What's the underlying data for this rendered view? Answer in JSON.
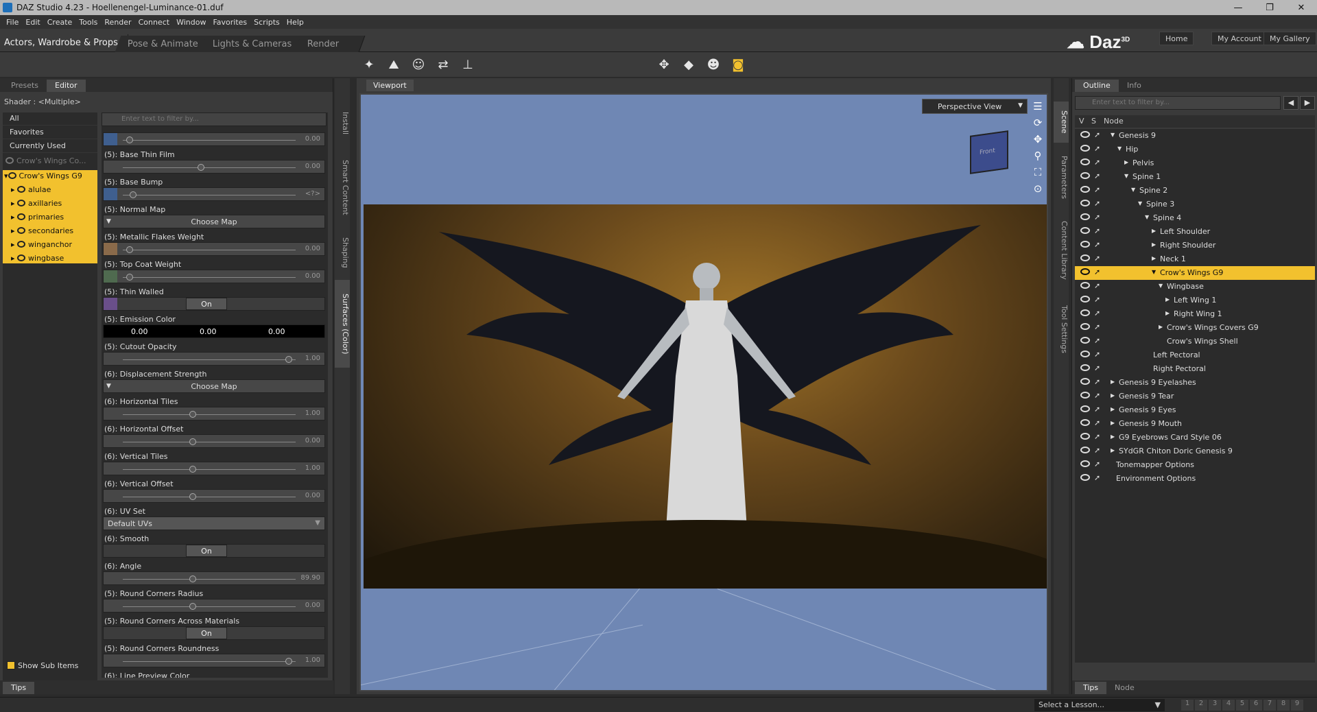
{
  "window": {
    "title": "DAZ Studio 4.23 - Hoellenengel-Luminance-01.duf",
    "controls": [
      "—",
      "❐",
      "✕"
    ]
  },
  "menu": [
    "File",
    "Edit",
    "Create",
    "Tools",
    "Render",
    "Connect",
    "Window",
    "Favorites",
    "Scripts",
    "Help"
  ],
  "main_tabs": [
    "Actors, Wardrobe & Props",
    "Pose & Animate",
    "Lights & Cameras",
    "Render"
  ],
  "brand": {
    "name": "Daz",
    "sup": "3D"
  },
  "top_links": [
    "Home",
    "My Account",
    "My Gallery"
  ],
  "left_panel": {
    "tabs": [
      "Presets",
      "Editor"
    ],
    "shader_label": "Shader :",
    "shader_value": "<Multiple>",
    "categories": [
      "All",
      "Favorites",
      "Currently Used"
    ],
    "tree": [
      {
        "label": "Crow's Wings Co...",
        "dim": true
      },
      {
        "label": "Crow's Wings G9"
      },
      {
        "label": "alulae"
      },
      {
        "label": "axillaries"
      },
      {
        "label": "primaries"
      },
      {
        "label": "secondaries"
      },
      {
        "label": "winganchor"
      },
      {
        "label": "wingbase"
      }
    ],
    "filter_placeholder": "Enter text to filter by...",
    "show_sub_items": "Show Sub Items",
    "tips": "Tips",
    "properties": [
      {
        "label": "",
        "type": "slider",
        "value": "0.00",
        "knob": 0.02,
        "swatch": "#3f5f8f"
      },
      {
        "label": "(5): Base Thin Film",
        "type": "slider",
        "value": "0.00",
        "knob": 0.45
      },
      {
        "label": "(5): Base Bump",
        "type": "slider",
        "value": "<?>",
        "knob": 0.04,
        "swatch": "#3f5f8f"
      },
      {
        "label": "(5): Normal Map",
        "type": "button",
        "button": "Choose Map"
      },
      {
        "label": "(5): Metallic Flakes Weight",
        "type": "slider",
        "value": "0.00",
        "knob": 0.02,
        "swatch": "#8a6a4a"
      },
      {
        "label": "(5): Top Coat Weight",
        "type": "slider",
        "value": "0.00",
        "knob": 0.02,
        "swatch": "#4f6a4f"
      },
      {
        "label": "(5): Thin Walled",
        "type": "toggle",
        "button": "On",
        "swatch": "#6a4f8a"
      },
      {
        "label": "(5): Emission Color",
        "type": "color",
        "values": [
          "0.00",
          "0.00",
          "0.00"
        ]
      },
      {
        "label": "(5): Cutout Opacity",
        "type": "slider",
        "value": "1.00",
        "knob": 0.98
      },
      {
        "label": "(6): Displacement Strength",
        "type": "button",
        "button": "Choose Map"
      },
      {
        "label": "(6): Horizontal Tiles",
        "type": "slider",
        "value": "1.00",
        "knob": 0.4
      },
      {
        "label": "(6): Horizontal Offset",
        "type": "slider",
        "value": "0.00",
        "knob": 0.4
      },
      {
        "label": "(6): Vertical Tiles",
        "type": "slider",
        "value": "1.00",
        "knob": 0.4
      },
      {
        "label": "(6): Vertical Offset",
        "type": "slider",
        "value": "0.00",
        "knob": 0.4
      },
      {
        "label": "(6): UV Set",
        "type": "select",
        "button": "Default UVs"
      },
      {
        "label": "(6): Smooth",
        "type": "toggle",
        "button": "On"
      },
      {
        "label": "(6): Angle",
        "type": "slider",
        "value": "89.90",
        "knob": 0.4
      },
      {
        "label": "(5): Round Corners Radius",
        "type": "slider",
        "value": "0.00",
        "knob": 0.4
      },
      {
        "label": "(5): Round Corners Across Materials",
        "type": "toggle",
        "button": "On"
      },
      {
        "label": "(5): Round Corners Roundness",
        "type": "slider",
        "value": "1.00",
        "knob": 0.98
      },
      {
        "label": "(6): Line Preview Color",
        "type": "none"
      }
    ]
  },
  "left_dock_tabs": [
    "Install",
    "Smart Content",
    "Shaping",
    "Surfaces (Color)"
  ],
  "viewport": {
    "tab": "Viewport",
    "view_mode": "Perspective View",
    "nav_cube_label": "Front",
    "colors": {
      "sky": "#6f87b4",
      "highlight": "#f2c12e"
    }
  },
  "right_dock_tabs": [
    "Scene",
    "Parameters",
    "Content Library",
    "Tool Settings"
  ],
  "right_panel": {
    "tabs": [
      "Outline",
      "Info"
    ],
    "filter_placeholder": "Enter text to filter by...",
    "columns": [
      "V",
      "S",
      "Node"
    ],
    "nodes": [
      {
        "label": "Genesis 9",
        "depth": 0,
        "exp": "▼"
      },
      {
        "label": "Hip",
        "depth": 1,
        "exp": "▼"
      },
      {
        "label": "Pelvis",
        "depth": 2,
        "exp": "▶"
      },
      {
        "label": "Spine 1",
        "depth": 2,
        "exp": "▼"
      },
      {
        "label": "Spine 2",
        "depth": 3,
        "exp": "▼"
      },
      {
        "label": "Spine 3",
        "depth": 4,
        "exp": "▼"
      },
      {
        "label": "Spine 4",
        "depth": 5,
        "exp": "▼"
      },
      {
        "label": "Left Shoulder",
        "depth": 6,
        "exp": "▶"
      },
      {
        "label": "Right Shoulder",
        "depth": 6,
        "exp": "▶"
      },
      {
        "label": "Neck 1",
        "depth": 6,
        "exp": "▶"
      },
      {
        "label": "Crow's Wings G9",
        "depth": 6,
        "exp": "▼",
        "selected": true
      },
      {
        "label": "Wingbase",
        "depth": 7,
        "exp": "▼"
      },
      {
        "label": "Left Wing 1",
        "depth": 8,
        "exp": "▶"
      },
      {
        "label": "Right Wing 1",
        "depth": 8,
        "exp": "▶"
      },
      {
        "label": "Crow's Wings Covers G9",
        "depth": 7,
        "exp": "▶"
      },
      {
        "label": "Crow's Wings Shell",
        "depth": 7,
        "exp": ""
      },
      {
        "label": "Left Pectoral",
        "depth": 5,
        "exp": ""
      },
      {
        "label": "Right Pectoral",
        "depth": 5,
        "exp": ""
      },
      {
        "label": "Genesis 9 Eyelashes",
        "depth": 0,
        "exp": "▶"
      },
      {
        "label": "Genesis 9 Tear",
        "depth": 0,
        "exp": "▶"
      },
      {
        "label": "Genesis 9 Eyes",
        "depth": 0,
        "exp": "▶"
      },
      {
        "label": "Genesis 9 Mouth",
        "depth": 0,
        "exp": "▶"
      },
      {
        "label": "G9 Eyebrows Card Style 06",
        "depth": 0,
        "exp": "▶"
      },
      {
        "label": "SYdGR Chiton Doric Genesis 9",
        "depth": 0,
        "exp": "▶"
      },
      {
        "label": "Tonemapper Options",
        "depth": -1,
        "exp": ""
      },
      {
        "label": "Environment Options",
        "depth": -1,
        "exp": ""
      }
    ],
    "bottom_tabs": [
      "Tips",
      "Node"
    ]
  },
  "status": {
    "lesson": "Select a Lesson...",
    "pages": [
      "1",
      "2",
      "3",
      "4",
      "5",
      "6",
      "7",
      "8",
      "9"
    ]
  }
}
